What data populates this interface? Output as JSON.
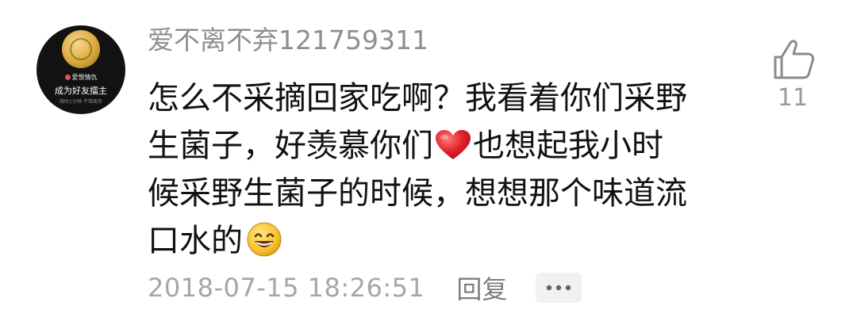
{
  "comment": {
    "avatar": {
      "brand": "爱恨情仇",
      "headline": "成为好友擂主",
      "fine_print": "限时1分钟 不错离你"
    },
    "username": "爱不离不弃121759311",
    "body_lines": [
      "怎么不采摘回家吃啊？我看着你们采野",
      "生菌子，好羡慕你们",
      "也想起我小时",
      "候采野生菌子的时候，想想那个味道流",
      "口水的"
    ],
    "timestamp": "2018-07-15 18:26:51",
    "reply_label": "回复",
    "more_icon": "ellipsis-icon",
    "like": {
      "icon": "thumbs-up-icon",
      "count": "11"
    }
  }
}
